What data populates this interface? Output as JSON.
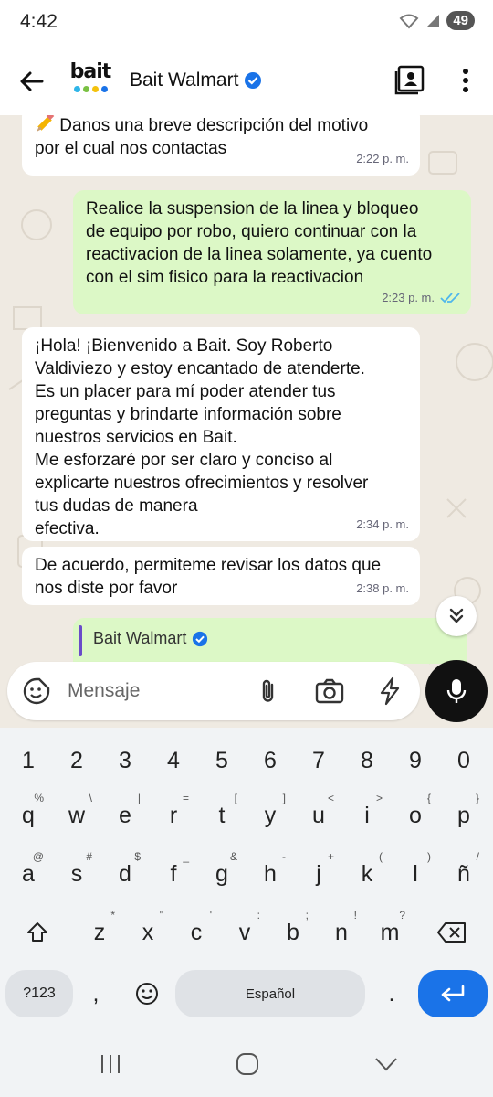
{
  "status": {
    "time": "4:42",
    "battery": "49"
  },
  "header": {
    "contact_name": "Bait Walmart",
    "logo_text": "bait"
  },
  "messages": [
    {
      "dir": "in",
      "text": "Danos una breve descripción del motivo\npor el cual nos contactas",
      "time": "2:22 p. m."
    },
    {
      "dir": "out",
      "text": "Realice la suspension de la linea y bloqueo\nde equipo por robo, quiero continuar con la\nreactivacion de la linea solamente, ya cuento\ncon el sim fisico para la reactivacion",
      "time": "2:23 p. m."
    },
    {
      "dir": "in",
      "text": "¡Hola! ¡Bienvenido a Bait. Soy Roberto\nValdiviezo y estoy encantado de atenderte.\nEs un placer para mí poder atender tus\npreguntas y brindarte información sobre\nnuestros servicios en Bait.\nMe esforzaré por ser claro y conciso al\nexplicarte nuestros ofrecimientos y resolver\ntus dudas de manera\nefectiva.",
      "time": "2:34 p. m."
    },
    {
      "dir": "in",
      "text": "De acuerdo, permiteme revisar los datos que\nnos diste por favor",
      "time": "2:38 p. m."
    }
  ],
  "quoted": {
    "name": "Bait Walmart"
  },
  "input": {
    "placeholder": "Mensaje"
  },
  "keyboard": {
    "numbers": [
      "1",
      "2",
      "3",
      "4",
      "5",
      "6",
      "7",
      "8",
      "9",
      "0"
    ],
    "row1": [
      {
        "k": "q",
        "h": "%"
      },
      {
        "k": "w",
        "h": "\\"
      },
      {
        "k": "e",
        "h": "|"
      },
      {
        "k": "r",
        "h": "="
      },
      {
        "k": "t",
        "h": "["
      },
      {
        "k": "y",
        "h": "]"
      },
      {
        "k": "u",
        "h": "<"
      },
      {
        "k": "i",
        "h": ">"
      },
      {
        "k": "o",
        "h": "{"
      },
      {
        "k": "p",
        "h": "}"
      }
    ],
    "row2": [
      {
        "k": "a",
        "h": "@"
      },
      {
        "k": "s",
        "h": "#"
      },
      {
        "k": "d",
        "h": "$"
      },
      {
        "k": "f",
        "h": "_"
      },
      {
        "k": "g",
        "h": "&"
      },
      {
        "k": "h",
        "h": "-"
      },
      {
        "k": "j",
        "h": "+"
      },
      {
        "k": "k",
        "h": "("
      },
      {
        "k": "l",
        "h": ")"
      },
      {
        "k": "ñ",
        "h": "/"
      }
    ],
    "row3": [
      {
        "k": "z",
        "h": "*"
      },
      {
        "k": "x",
        "h": "\""
      },
      {
        "k": "c",
        "h": "'"
      },
      {
        "k": "v",
        "h": ":"
      },
      {
        "k": "b",
        "h": ";"
      },
      {
        "k": "n",
        "h": "!"
      },
      {
        "k": "m",
        "h": "?"
      }
    ],
    "sym_label": "?123",
    "comma": ",",
    "period": ".",
    "space_label": "Español"
  },
  "colors": {
    "accent": "#1a73e8",
    "incoming": "#ffffff",
    "outgoing": "#dcf8c6",
    "wallpaper": "#efeae2",
    "verified": "#1da1f2"
  }
}
